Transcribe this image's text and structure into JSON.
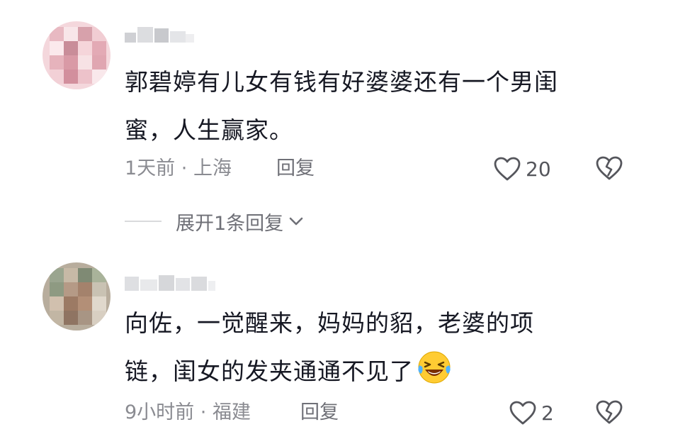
{
  "comments": [
    {
      "text_line1": "郭碧婷有儿女有钱有好婆婆还有一个男闺",
      "text_line2": "蜜，人生赢家。",
      "time": "1天前",
      "separator": "·",
      "location": "上海",
      "reply_label": "回复",
      "like_count": "20",
      "avatar_colors": [
        "#f4d7dc",
        "#e8b9c2",
        "#f8e6e9",
        "#d7a1ab"
      ]
    },
    {
      "text_line1": "向佐，一觉醒来，妈妈的貂，老婆的项",
      "text_line2": "链，闺女的发夹通通不见了",
      "emoji": "grinning-squinting-tears-emoji",
      "time": "9小时前",
      "separator": "·",
      "location": "福建",
      "reply_label": "回复",
      "like_count": "2",
      "avatar_colors": [
        "#9aa58f",
        "#b59a86",
        "#7f8a74",
        "#d1c0ae"
      ]
    }
  ],
  "expand_replies": {
    "label": "展开1条回复"
  },
  "colors": {
    "text": "#161823",
    "meta": "#8a8b91",
    "icon": "#55565c"
  },
  "icons": [
    "heart-outline-icon",
    "broken-heart-icon",
    "chevron-down-icon"
  ]
}
